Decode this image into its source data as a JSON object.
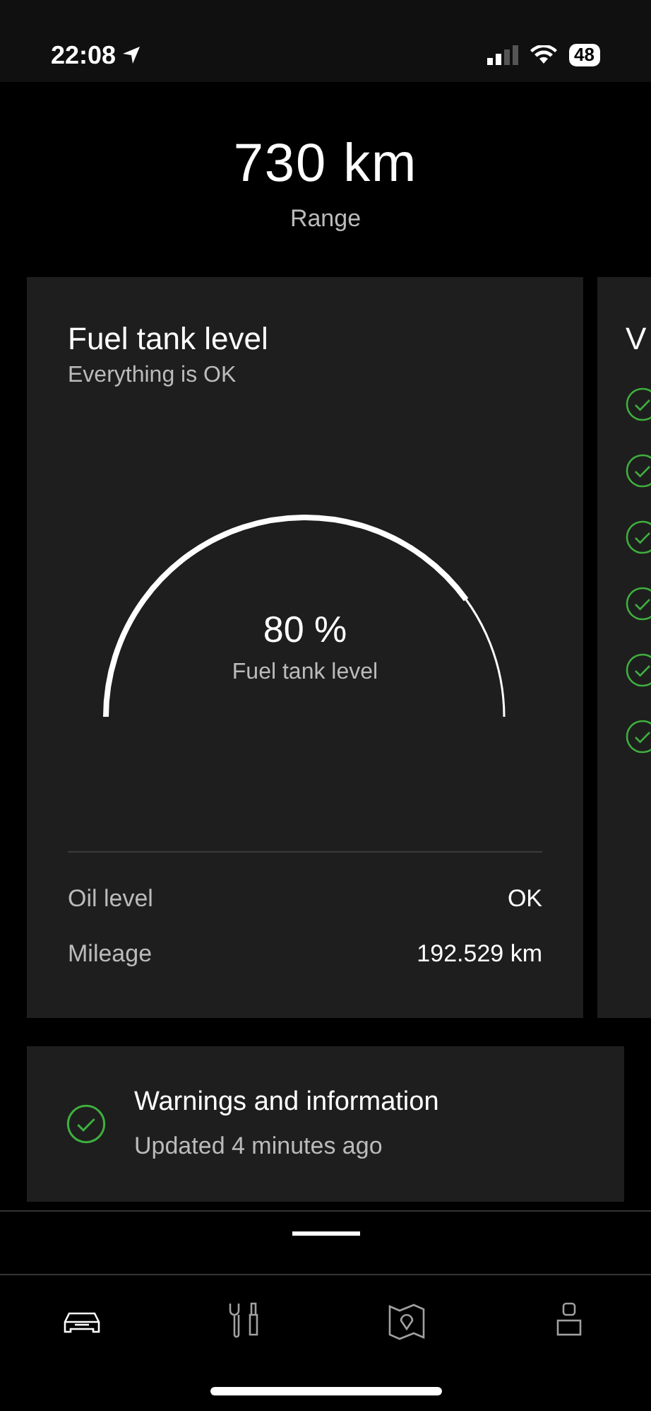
{
  "status_bar": {
    "time": "22:08",
    "battery": "48"
  },
  "range": {
    "value": "730 km",
    "label": "Range"
  },
  "fuel_card": {
    "title": "Fuel tank level",
    "subtitle": "Everything is OK",
    "gauge": {
      "reading": "80 %",
      "label": "Fuel tank level"
    },
    "rows": [
      {
        "label": "Oil level",
        "value": "OK"
      },
      {
        "label": "Mileage",
        "value": "192.529 km"
      }
    ]
  },
  "second_card": {
    "title": "V",
    "checks": [
      {
        "ok": true
      },
      {
        "ok": true
      },
      {
        "ok": true
      },
      {
        "ok": true
      },
      {
        "ok": true
      },
      {
        "ok": true
      }
    ]
  },
  "warnings": {
    "title": "Warnings and information",
    "subtitle": "Updated 4 minutes ago",
    "ok": true
  },
  "tab_bar": [
    {
      "kind": "car",
      "selected": true
    },
    {
      "kind": "service",
      "selected": false
    },
    {
      "kind": "map",
      "selected": false
    },
    {
      "kind": "profile",
      "selected": false
    }
  ]
}
